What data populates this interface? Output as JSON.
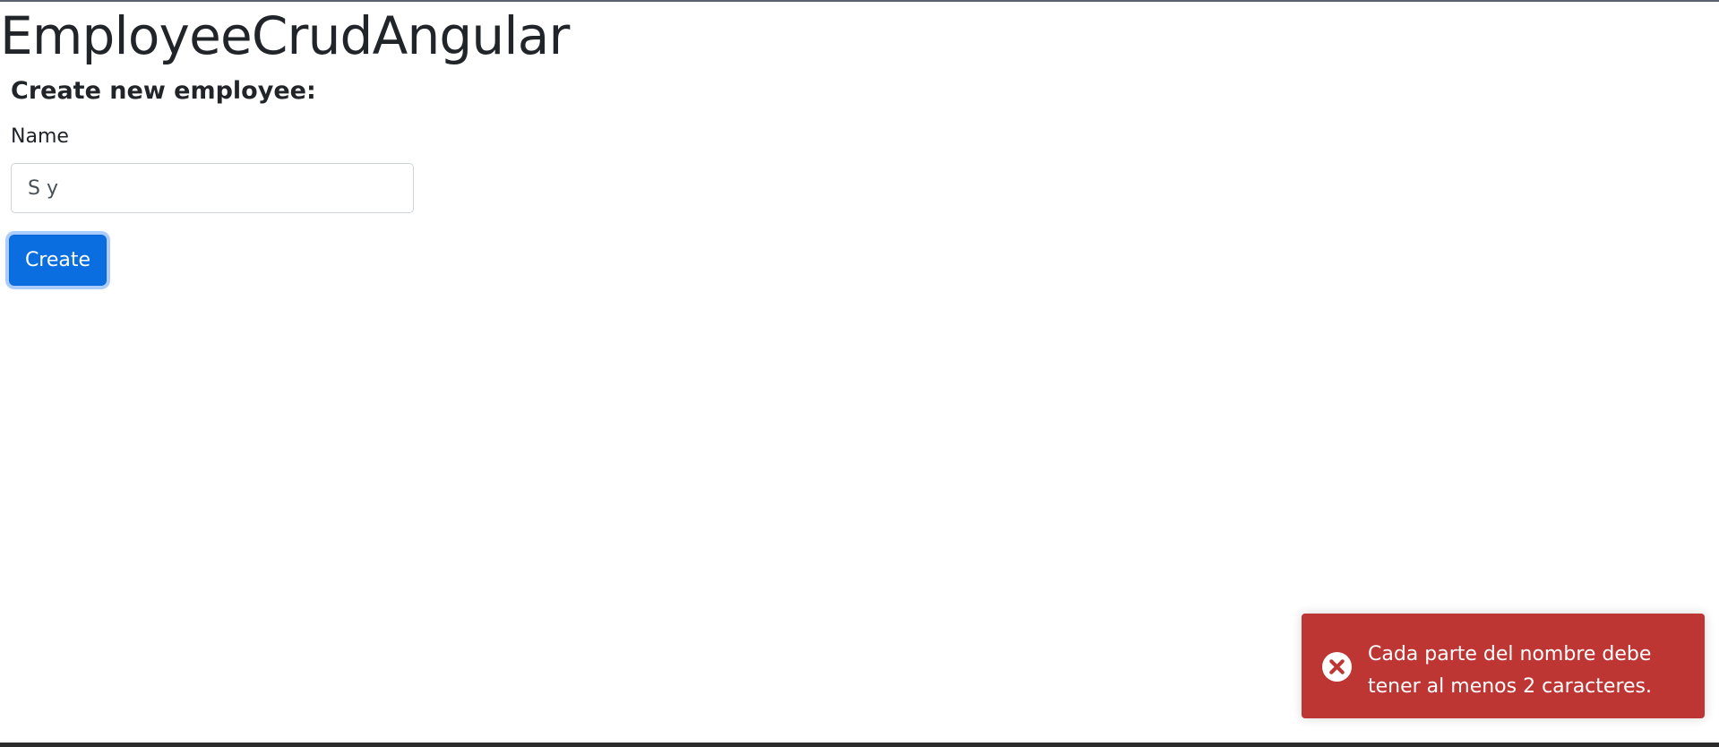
{
  "app": {
    "title": "EmployeeCrudAngular"
  },
  "form": {
    "section_title": "Create new employee:",
    "name_label": "Name",
    "name_value": "S y",
    "create_button_label": "Create"
  },
  "toast": {
    "type": "error",
    "message": "Cada parte del nombre debe tener al menos 2 caracteres.",
    "icon": "close-circle-icon",
    "background_color": "#be3633"
  },
  "theme": {
    "primary_color": "#0b6ee0",
    "text_color": "#212529"
  }
}
